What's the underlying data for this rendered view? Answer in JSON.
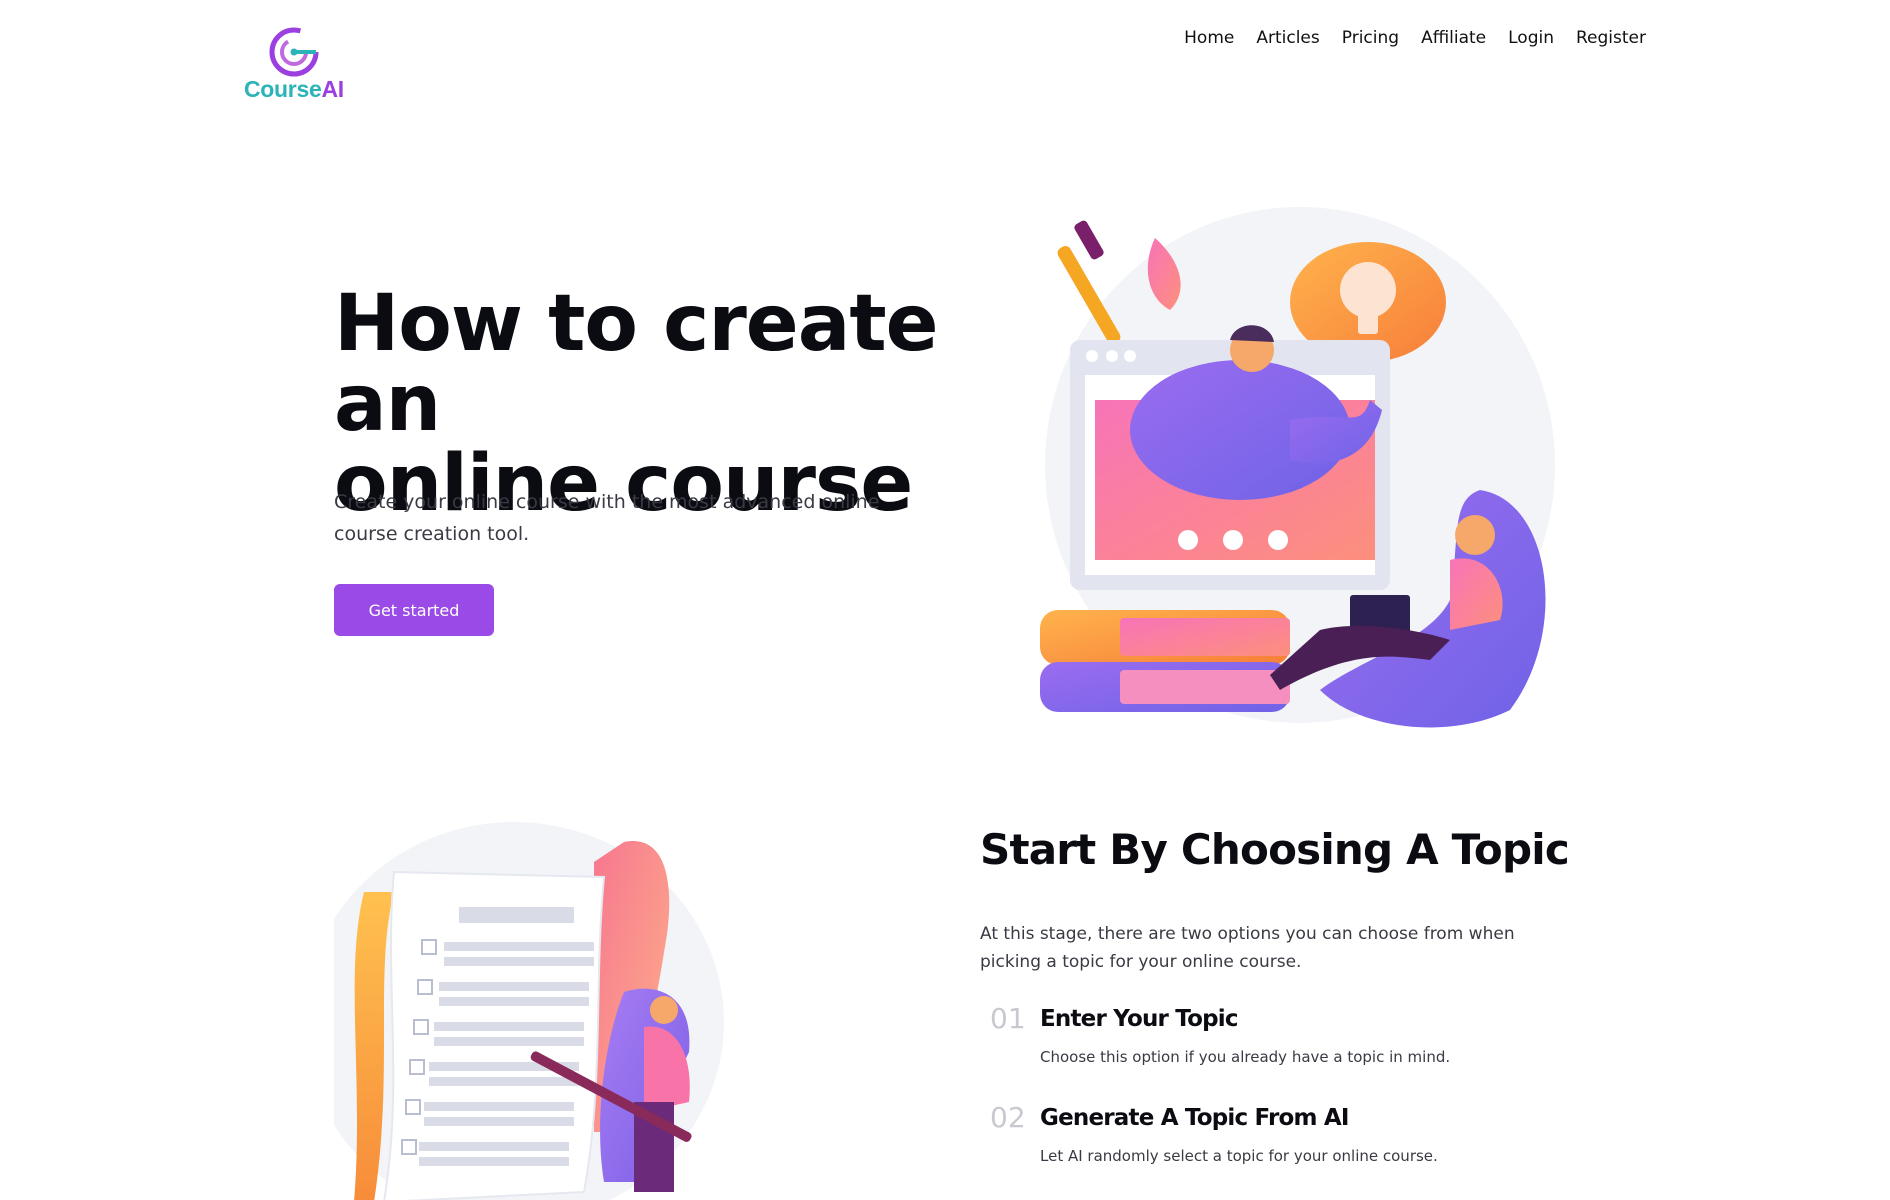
{
  "brand": {
    "name_part1": "Course",
    "name_part2": "AI",
    "colors": {
      "teal": "#2bb3b8",
      "purple": "#9b3fe0"
    }
  },
  "nav": {
    "items": [
      "Home",
      "Articles",
      "Pricing",
      "Affiliate",
      "Login",
      "Register"
    ]
  },
  "hero": {
    "title_line1": "How to create an",
    "title_line2": "online course",
    "subtitle": "Create your online course with the most advanced online course creation tool.",
    "cta_label": "Get started",
    "cta_color": "#9a4ae6",
    "illustration": "teacher-online-course-illustration"
  },
  "topic_section": {
    "title": "Start By Choosing A Topic",
    "description": "At this stage, there are two options you can choose from when picking a topic for your online course.",
    "illustration": "checklist-with-pencil-illustration",
    "steps": [
      {
        "number": "01",
        "title": "Enter Your Topic",
        "description": "Choose this option if you already have a topic in mind."
      },
      {
        "number": "02",
        "title": "Generate A Topic From AI",
        "description": "Let AI randomly select a topic for your online course."
      }
    ]
  }
}
